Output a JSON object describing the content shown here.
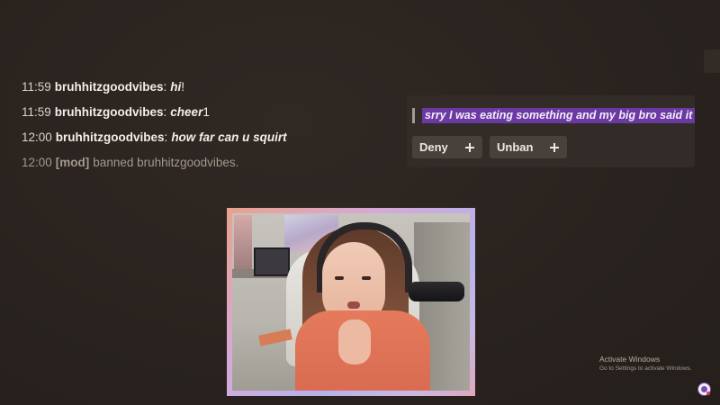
{
  "chat": {
    "lines": [
      {
        "time": "11:59",
        "user": "bruhhitzgoodvibes",
        "message": "hi",
        "tail": "!"
      },
      {
        "time": "11:59",
        "user": "bruhhitzgoodvibes",
        "message": "cheer",
        "tail": "1"
      },
      {
        "time": "12:00",
        "user": "bruhhitzgoodvibes",
        "message": "how far can u squirt",
        "tail": ""
      }
    ],
    "mod_line": {
      "time": "12:00",
      "tag": "[mod]",
      "text": "banned bruhhitzgoodvibes."
    }
  },
  "mod_panel": {
    "message": "srry I was eating something and my big bro said it",
    "deny_label": "Deny",
    "unban_label": "Unban"
  },
  "watermark": {
    "title": "Activate Windows",
    "subtitle": "Go to Settings to activate Windows."
  },
  "colors": {
    "highlight": "#6a3aa2",
    "panel_bg": "#332b27",
    "page_bg": "#2b2420"
  }
}
